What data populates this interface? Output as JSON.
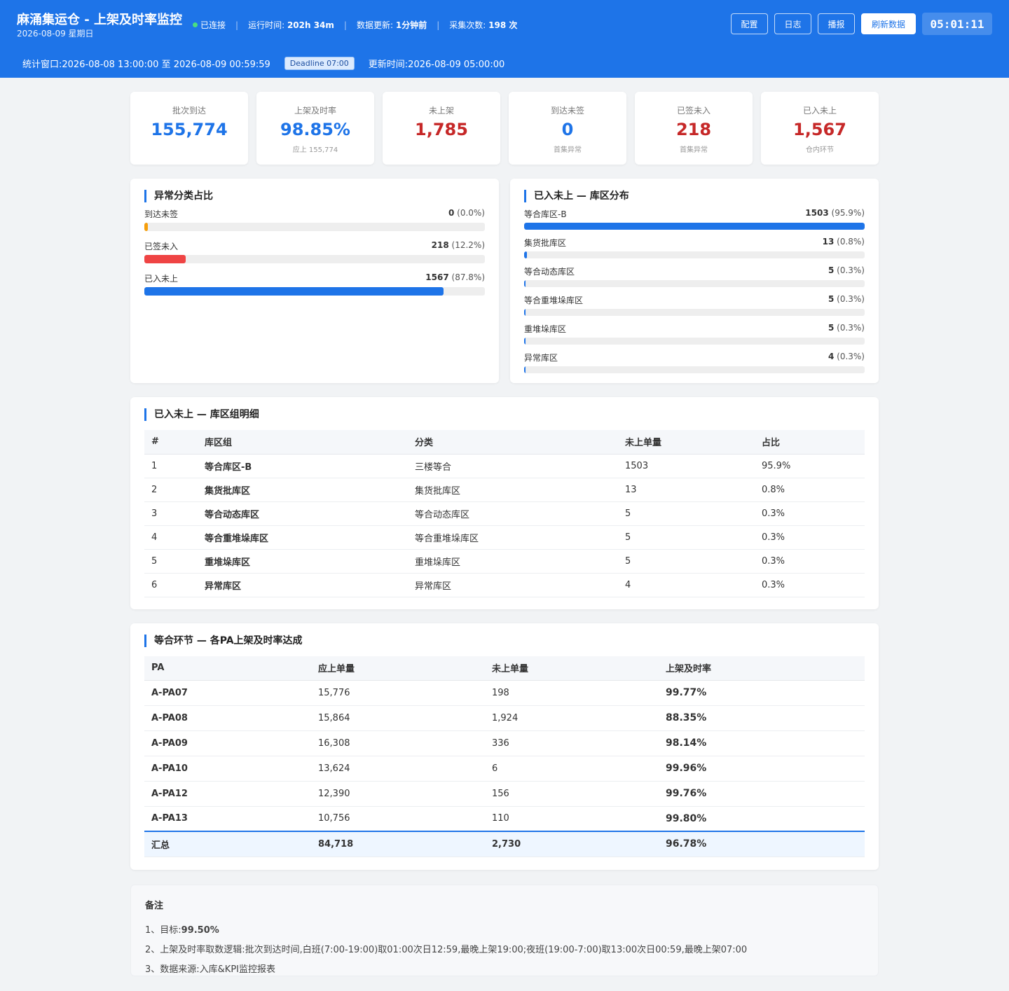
{
  "header": {
    "title": "麻涌集运仓 - 上架及时率监控",
    "date": "2026-08-09 星期日",
    "status": "已连接",
    "runtime_label": "运行时间:",
    "runtime_value": "202h 34m",
    "update_label": "数据更新:",
    "update_value": "1分钟前",
    "count_label": "采集次数:",
    "count_value": "198 次",
    "buttons": {
      "config": "配置",
      "log": "日志",
      "broadcast": "播报",
      "refresh": "刷新数据"
    },
    "clock": "05:01:11",
    "window_text": "统计窗口:2026-08-08 13:00:00 至 2026-08-09 00:59:59",
    "deadline": "Deadline 07:00",
    "updated_text": "更新时间:2026-08-09 05:00:00"
  },
  "kpis": [
    {
      "label": "批次到达",
      "value": "155,774",
      "sub": "",
      "color": "#1e74e8"
    },
    {
      "label": "上架及时率",
      "value": "98.85%",
      "sub": "应上 155,774",
      "color": "#1e74e8"
    },
    {
      "label": "未上架",
      "value": "1,785",
      "sub": "",
      "color": "#c62828"
    },
    {
      "label": "到达未签",
      "value": "0",
      "sub": "首集异常",
      "color": "#1e74e8"
    },
    {
      "label": "已签未入",
      "value": "218",
      "sub": "首集异常",
      "color": "#c62828"
    },
    {
      "label": "已入未上",
      "value": "1,567",
      "sub": "仓内环节",
      "color": "#c62828"
    }
  ],
  "anomaly": {
    "title": "异常分类占比",
    "items": [
      {
        "label": "到达未签",
        "count": "0",
        "pct": "(0.0%)",
        "fraction": 0.01,
        "color": "#f59e0b"
      },
      {
        "label": "已签未入",
        "count": "218",
        "pct": "(12.2%)",
        "fraction": 0.122,
        "color": "#ef4444"
      },
      {
        "label": "已入未上",
        "count": "1567",
        "pct": "(87.8%)",
        "fraction": 0.878,
        "color": "#1e74e8"
      }
    ]
  },
  "zone_dist": {
    "title": "已入未上 — 库区分布",
    "items": [
      {
        "label": "等合库区-B",
        "count": "1503",
        "pct": "(95.9%)",
        "fraction": 1.0
      },
      {
        "label": "集货批库区",
        "count": "13",
        "pct": "(0.8%)",
        "fraction": 0.009
      },
      {
        "label": "等合动态库区",
        "count": "5",
        "pct": "(0.3%)",
        "fraction": 0.003
      },
      {
        "label": "等合重堆垛库区",
        "count": "5",
        "pct": "(0.3%)",
        "fraction": 0.003
      },
      {
        "label": "重堆垛库区",
        "count": "5",
        "pct": "(0.3%)",
        "fraction": 0.003
      },
      {
        "label": "异常库区",
        "count": "4",
        "pct": "(0.3%)",
        "fraction": 0.003
      }
    ]
  },
  "zone_table": {
    "title": "已入未上 — 库区组明细",
    "columns": [
      "#",
      "库区组",
      "分类",
      "未上单量",
      "占比"
    ],
    "rows": [
      [
        "1",
        "等合库区-B",
        "三楼等合",
        "1503",
        "95.9%"
      ],
      [
        "2",
        "集货批库区",
        "集货批库区",
        "13",
        "0.8%"
      ],
      [
        "3",
        "等合动态库区",
        "等合动态库区",
        "5",
        "0.3%"
      ],
      [
        "4",
        "等合重堆垛库区",
        "等合重堆垛库区",
        "5",
        "0.3%"
      ],
      [
        "5",
        "重堆垛库区",
        "重堆垛库区",
        "5",
        "0.3%"
      ],
      [
        "6",
        "异常库区",
        "异常库区",
        "4",
        "0.3%"
      ]
    ]
  },
  "pa_table": {
    "title": "等合环节 — 各PA上架及时率达成",
    "columns": [
      "PA",
      "应上单量",
      "未上单量",
      "上架及时率"
    ],
    "rows": [
      [
        "A-PA07",
        "15,776",
        "198",
        "99.77%"
      ],
      [
        "A-PA08",
        "15,864",
        "1,924",
        "88.35%"
      ],
      [
        "A-PA09",
        "16,308",
        "336",
        "98.14%"
      ],
      [
        "A-PA10",
        "13,624",
        "6",
        "99.96%"
      ],
      [
        "A-PA12",
        "12,390",
        "156",
        "99.76%"
      ],
      [
        "A-PA13",
        "10,756",
        "110",
        "99.80%"
      ]
    ],
    "total": [
      "汇总",
      "84,718",
      "2,730",
      "96.78%"
    ]
  },
  "notes": {
    "title": "备注",
    "line1_prefix": "1、目标:",
    "line1_value": "99.50%",
    "line2": "2、上架及时率取数逻辑:批次到达时间,白班(7:00-19:00)取01:00次日12:59,最晚上架19:00;夜班(19:00-7:00)取13:00次日00:59,最晚上架07:00",
    "line3": "3、数据来源:入库&KPI监控报表"
  }
}
